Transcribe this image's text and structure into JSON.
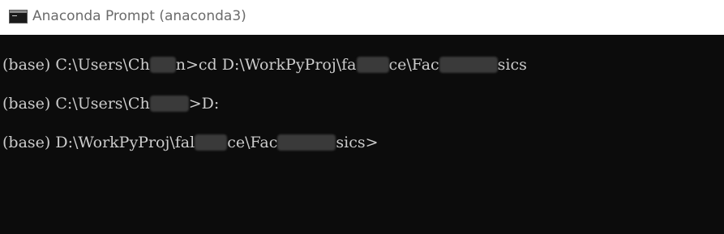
{
  "window": {
    "title": "Anaconda Prompt (anaconda3)",
    "icon": "terminal-icon"
  },
  "console": {
    "lines": [
      {
        "prefix": "(base) C:\\Users\\Ch",
        "middle": "n>cd D:\\WorkPyProj\\fa",
        "middle2": "ce\\Fac",
        "end": "sics"
      },
      {
        "prefix": "(base) C:\\Users\\Ch",
        "end": ">D:"
      },
      {
        "prefix": "(base) D:\\WorkPyProj\\fal",
        "middle": "ce\\Fac",
        "end": "sics>"
      }
    ]
  },
  "colors": {
    "titlebar_bg": "#ffffff",
    "console_bg": "#0c0c0c",
    "console_text": "#cccccc",
    "title_text": "#6b6b6b"
  }
}
